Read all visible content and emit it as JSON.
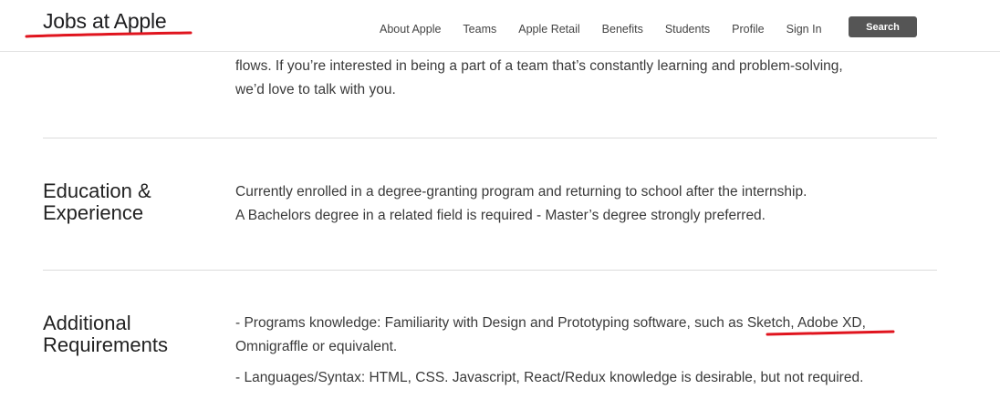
{
  "header": {
    "brand": "Jobs at Apple",
    "nav": [
      {
        "label": "About Apple"
      },
      {
        "label": "Teams"
      },
      {
        "label": "Apple Retail"
      },
      {
        "label": "Benefits"
      },
      {
        "label": "Students"
      },
      {
        "label": "Profile"
      },
      {
        "label": "Sign In"
      }
    ],
    "search_label": "Search"
  },
  "intro": {
    "line1": "flows. If you’re interested in being a part of a team that’s constantly learning and problem-solving,",
    "line2": "we’d love to talk with you."
  },
  "education": {
    "title_line1": "Education &",
    "title_line2": "Experience",
    "line1": "Currently enrolled in a degree-granting program and returning to school after the internship.",
    "line2": "A Bachelors degree in a related field is required - Master’s degree strongly preferred."
  },
  "additional": {
    "title_line1": "Additional",
    "title_line2": "Requirements",
    "programs_prefix": "- Programs knowledge: Familiarity with Design and Prototyping software, such as ",
    "programs_highlight": "Sketch, Adobe XD",
    "programs_suffix": ",",
    "programs_line2": "Omnigraffle or equivalent.",
    "languages": "- Languages/Syntax: HTML, CSS. Javascript, React/Redux knowledge is desirable, but not required."
  },
  "colors": {
    "annotation": "#e0141e",
    "search_button": "#555555"
  }
}
